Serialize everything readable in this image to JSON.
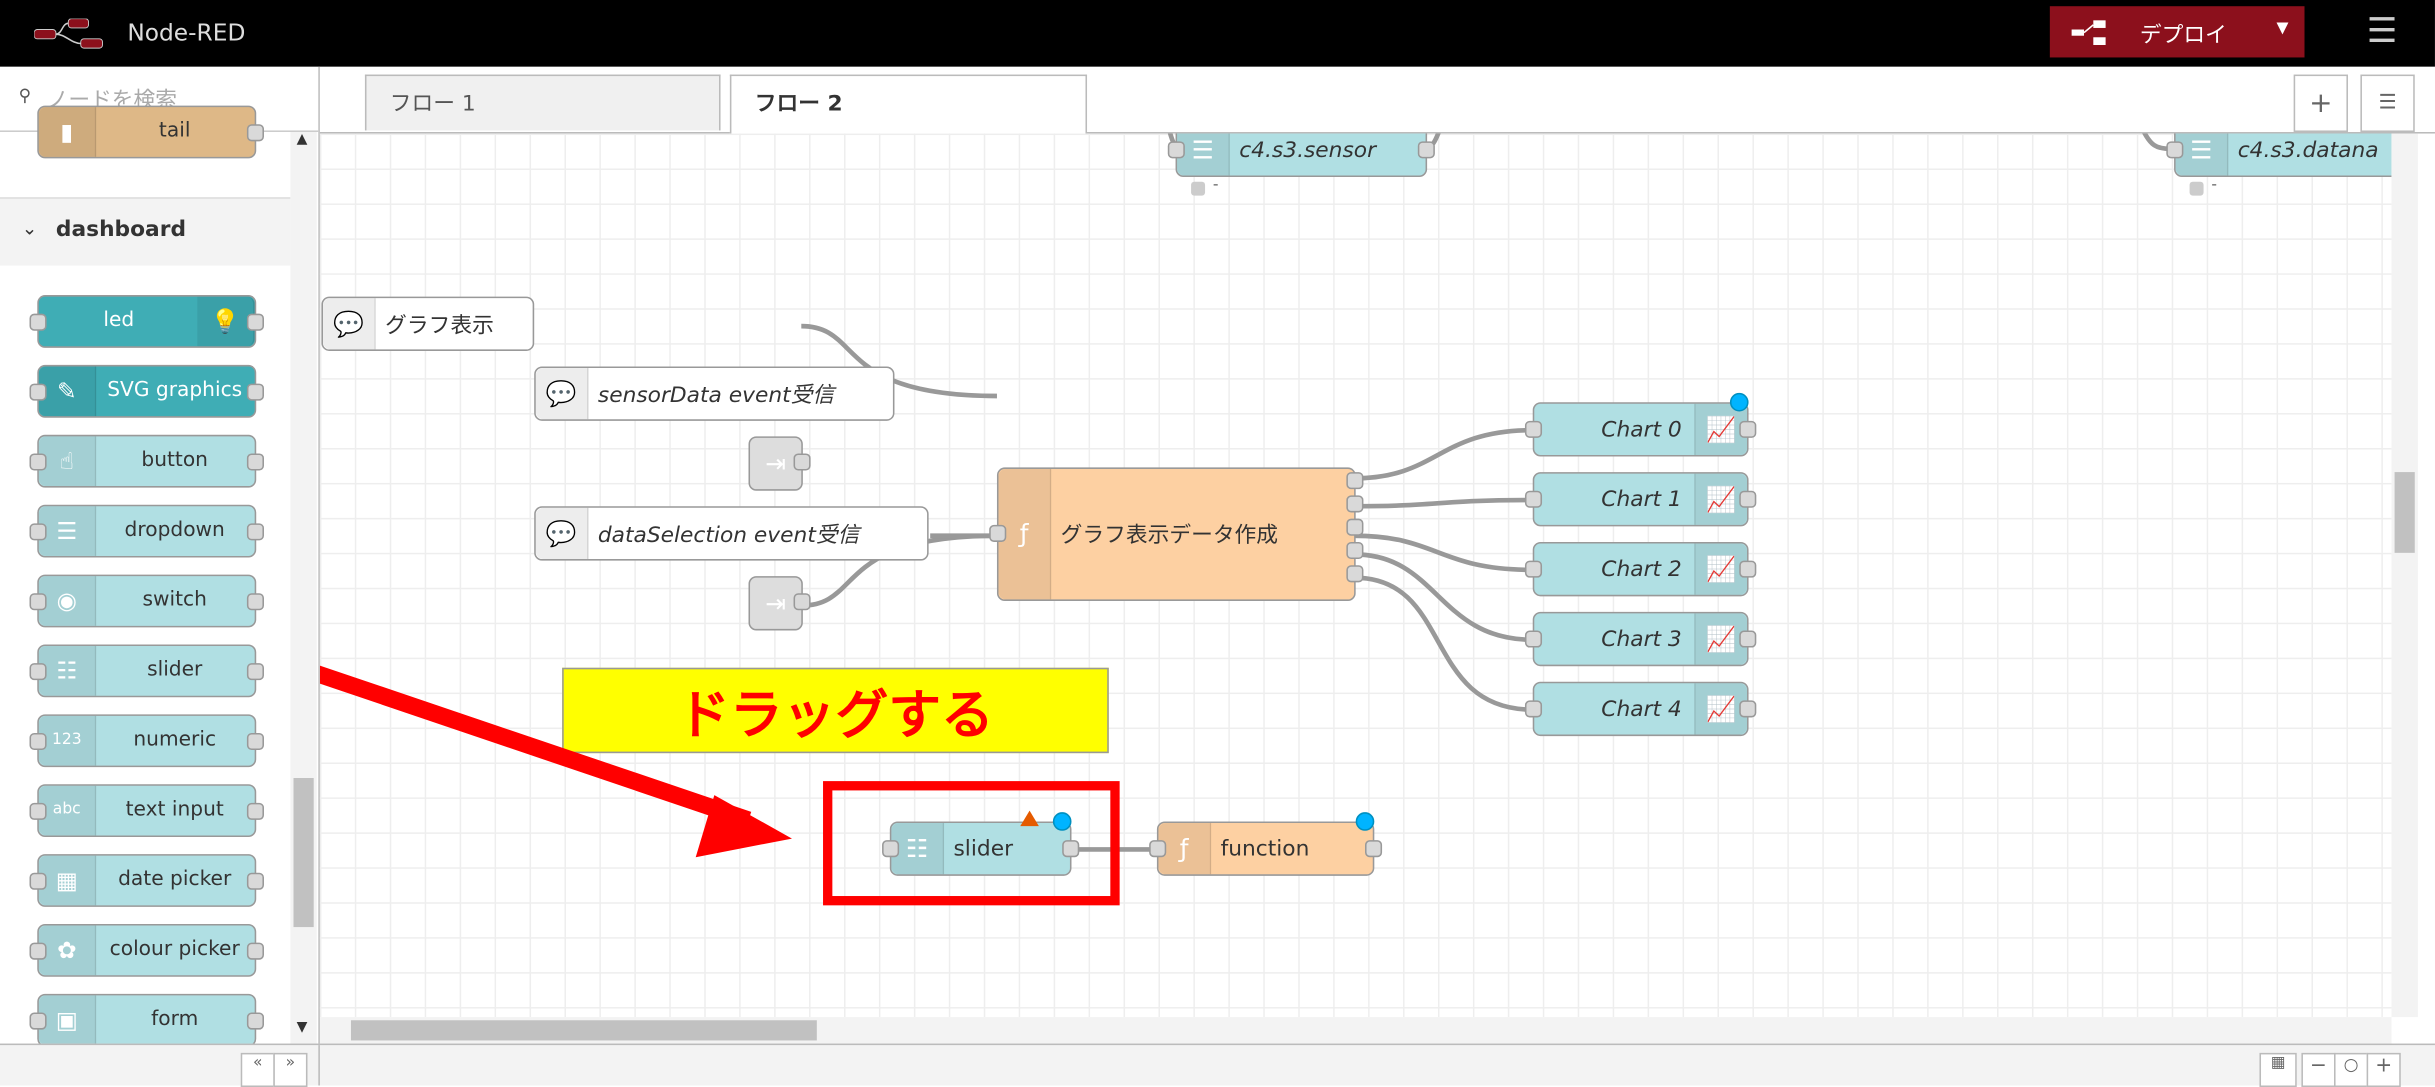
{
  "header": {
    "app_title": "Node-RED",
    "deploy_label": "デプロイ",
    "colors": {
      "deploy": "#8c101c",
      "header": "#000000"
    }
  },
  "palette": {
    "search_placeholder": "ノードを検索",
    "partial_node": "tail",
    "category": "dashboard",
    "items": [
      {
        "label": "led",
        "icon": "led-icon"
      },
      {
        "label": "SVG graphics",
        "icon": "pen-icon"
      },
      {
        "label": "button",
        "icon": "hand-pointer-icon"
      },
      {
        "label": "dropdown",
        "icon": "list-icon"
      },
      {
        "label": "switch",
        "icon": "toggle-icon"
      },
      {
        "label": "slider",
        "icon": "sliders-icon"
      },
      {
        "label": "numeric",
        "icon": "numeric-123-icon"
      },
      {
        "label": "text input",
        "icon": "abc-icon"
      },
      {
        "label": "date picker",
        "icon": "calendar-icon"
      },
      {
        "label": "colour picker",
        "icon": "palette-icon"
      },
      {
        "label": "form",
        "icon": "form-icon"
      }
    ]
  },
  "tabs": [
    {
      "label": "フロー 1",
      "active": false
    },
    {
      "label": "フロー 2",
      "active": true
    }
  ],
  "canvas": {
    "nodes": {
      "sensor": "c4.s3.sensor",
      "sensor_status": "-",
      "datana": "c4.s3.datana",
      "datana_status": "-",
      "comment_graph": "グラフ表示",
      "comment_sensor": "sensorData event受信",
      "comment_selection": "dataSelection event受信",
      "graph_function": "グラフ表示データ作成",
      "charts": [
        "Chart 0",
        "Chart 1",
        "Chart 2",
        "Chart 3",
        "Chart 4"
      ],
      "slider": "slider",
      "function": "function"
    },
    "annotation": {
      "text": "ドラッグする",
      "text_color": "#ff0000",
      "box_color": "#ffff00"
    }
  }
}
